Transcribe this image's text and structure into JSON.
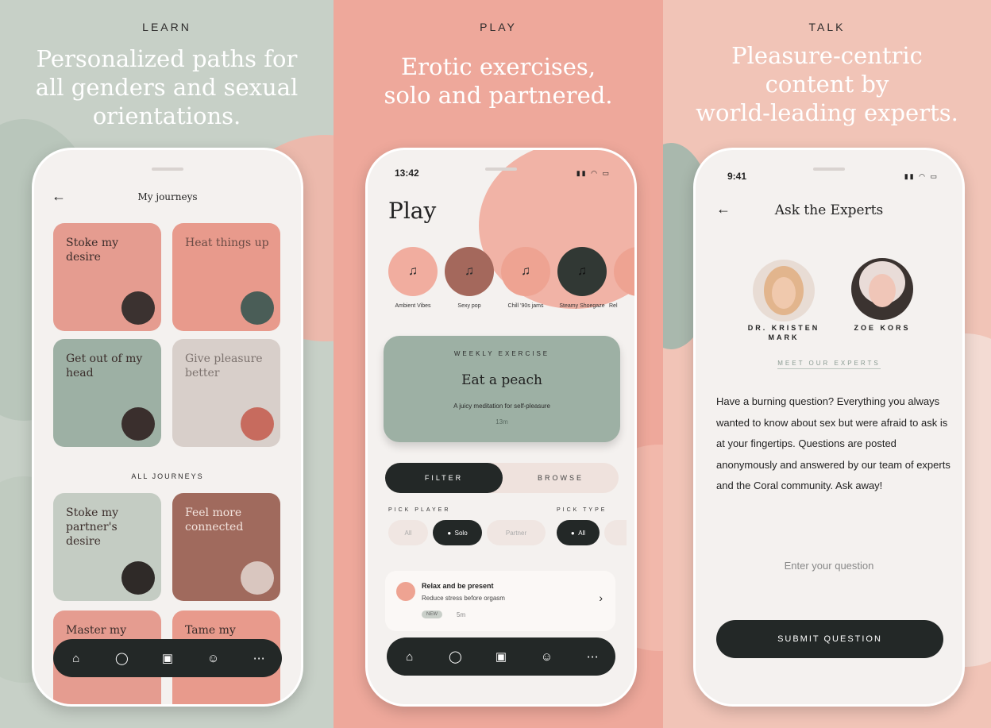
{
  "panels": [
    {
      "kicker": "LEARN",
      "headline_lines": [
        "Personalized paths for",
        "all genders and sexual",
        "orientations."
      ]
    },
    {
      "kicker": "PLAY",
      "headline_lines": [
        "Erotic exercises,",
        "solo and partnered."
      ]
    },
    {
      "kicker": "TALK",
      "headline_lines": [
        "Pleasure-centric",
        "content by",
        "world-leading experts."
      ]
    }
  ],
  "learn": {
    "title": "My journeys",
    "back_icon": "arrow-left-icon",
    "my_tiles": [
      {
        "label": "Stoke my desire",
        "color": "#e59c90",
        "deco": "#3b3230"
      },
      {
        "label": "Heat things up",
        "color": "#e89a8c",
        "deco": "#4a5d57"
      },
      {
        "label": "Get out of my head",
        "color": "#9db0a4",
        "deco": "#3a2f2d"
      },
      {
        "label": "Give pleasure better",
        "color": "#d8cfca",
        "deco": "#c76b5e"
      }
    ],
    "section_label": "ALL JOURNEYS",
    "all_tiles": [
      {
        "label": "Stoke my partner's desire",
        "color": "#c4ccc3",
        "deco": "#2f2a28"
      },
      {
        "label": "Feel more connected",
        "color": "#a06a5d",
        "deco": "#d9c6bf"
      },
      {
        "label": "Master my",
        "color": "#e59c90",
        "deco": "#3b3230"
      },
      {
        "label": "Tame my desire",
        "color": "#e89a8c",
        "deco": "#4a5d57"
      }
    ],
    "nav_icons": [
      "home-icon",
      "chat-icon",
      "cards-icon",
      "community-icon",
      "more-icon"
    ]
  },
  "play": {
    "time": "13:42",
    "title": "Play",
    "playlists": [
      {
        "label": "Ambient Vibes",
        "color": "#f1ad9f"
      },
      {
        "label": "Sexy pop",
        "color": "#a4685c"
      },
      {
        "label": "Chill '90s jams",
        "color": "#eea392"
      },
      {
        "label": "Steamy Shoegaze",
        "color": "#313834"
      },
      {
        "label": "Rel",
        "color": "#eea392"
      }
    ],
    "weekly": {
      "kicker": "WEEKLY EXERCISE",
      "title": "Eat a peach",
      "subtitle": "A juicy meditation for self-pleasure",
      "duration": "13m"
    },
    "toggle": {
      "active": "FILTER",
      "inactive": "BROWSE"
    },
    "pick_player": {
      "label": "PICK PLAYER",
      "options": [
        "All",
        "Solo",
        "Partner"
      ],
      "selected": "Solo"
    },
    "pick_type": {
      "label": "PICK TYPE",
      "options": [
        "All"
      ],
      "selected": "All"
    },
    "card": {
      "title": "Relax and be present",
      "subtitle": "Reduce stress before orgasm",
      "badge": "NEW",
      "duration": "5m"
    }
  },
  "talk": {
    "time": "9:41",
    "title": "Ask the Experts",
    "experts": [
      {
        "name": "DR. KRISTEN MARK"
      },
      {
        "name": "ZOE KORS"
      }
    ],
    "meet_link": "MEET OUR EXPERTS",
    "body": "Have a burning question? Everything you always wanted to know about sex but were afraid to ask is at your fingertips. Questions are posted anonymously and answered by our team of experts and the Coral community. Ask away!",
    "input_placeholder": "Enter your question",
    "submit_label": "SUBMIT QUESTION"
  }
}
